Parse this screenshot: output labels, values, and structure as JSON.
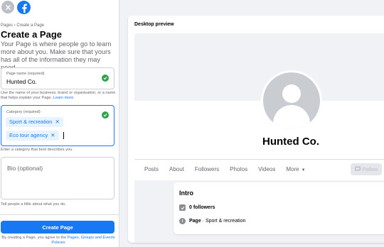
{
  "breadcrumb": "Pages › Create a Page",
  "title": "Create a Page",
  "description": "Your Page is where people go to learn more about you. Make sure that yours has all of the information they may need.",
  "page_name": {
    "label": "Page name (required)",
    "value": "Hunted Co."
  },
  "name_help": "Use the name of your business, brand or organisation, or a name that helps explain your Page.",
  "name_help_link": "Learn more",
  "category": {
    "label": "Category (required)",
    "chips": [
      "Sport & recreation",
      "Eco tour agency"
    ]
  },
  "category_help": "Enter a category that best describes you.",
  "bio": {
    "placeholder": "Bio (optional)"
  },
  "bio_help": "Tell people a little about what you do.",
  "create_button": "Create Page",
  "terms_prefix": "By creating a Page, you agree to the",
  "terms_link1": "Pages, Groups and Events Policies",
  "preview": {
    "label": "Desktop preview",
    "page_name": "Hunted Co.",
    "tabs": [
      "Posts",
      "About",
      "Followers",
      "Photos",
      "Videos",
      "More"
    ],
    "follow_label": "Follow",
    "intro_title": "Intro",
    "followers": "0 followers",
    "category_label": "Page",
    "category_value": " · Sport & recreation"
  },
  "colors": {
    "accent": "#1877f2",
    "success": "#31a24c"
  }
}
